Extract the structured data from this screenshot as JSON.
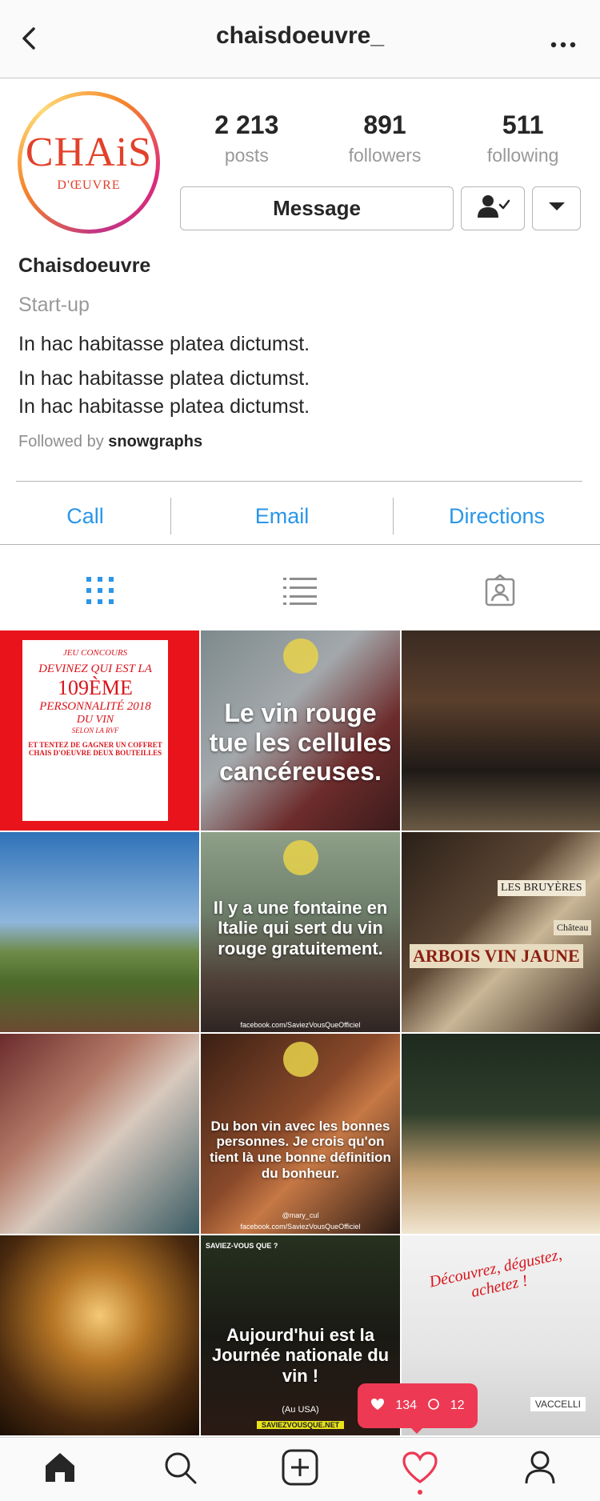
{
  "header": {
    "username": "chaisdoeuvre_"
  },
  "profile": {
    "logo_text": "CHAiS",
    "logo_sub": "D'ŒUVRE",
    "stats": [
      {
        "value": "2 213",
        "label": "posts"
      },
      {
        "value": "891",
        "label": "followers"
      },
      {
        "value": "511",
        "label": "following"
      }
    ],
    "message_label": "Message",
    "name": "Chaisdoeuvre",
    "category": "Start-up",
    "bio_lines": [
      "In hac habitasse platea dictumst.",
      "In hac habitasse platea dictumst.",
      "In hac habitasse platea dictumst."
    ],
    "followed_by_prefix": "Followed by",
    "followed_by_user": "snowgraphs"
  },
  "contact": {
    "call": "Call",
    "email": "Email",
    "directions": "Directions"
  },
  "tabs": [
    "grid-icon",
    "list-icon",
    "tagged-icon"
  ],
  "posts": [
    {
      "lines": [
        "JEU CONCOURS",
        "DEVINEZ QUI EST LA",
        "109ÈME",
        "PERSONNALITÉ 2018",
        "DU VIN",
        "SELON LA RVF",
        "ET TENTEZ DE GAGNER UN COFFRET",
        "CHAIS D'OEUVRE DEUX BOUTEILLES"
      ]
    },
    {
      "text": "Le vin rouge tue les cellules cancéreuses."
    },
    {
      "text": ""
    },
    {
      "text": ""
    },
    {
      "text": "Il y a une fontaine en Italie qui sert du vin rouge gratuitement.",
      "foot": "facebook.com/SaviezVousQueOfficiel"
    },
    {
      "text": "ARBOIS VIN JAUNE",
      "text2": "LES BRUYÈRES",
      "text3": "Château"
    },
    {
      "text": ""
    },
    {
      "text": "Du bon vin avec les bonnes personnes. Je crois qu'on tient là une bonne définition du bonheur.",
      "handle": "@mary_cul",
      "foot": "facebook.com/SaviezVousQueOfficiel"
    },
    {
      "text": ""
    },
    {
      "text": ""
    },
    {
      "top": "SAVIEZ-VOUS QUE ?",
      "text": "Aujourd'hui est la Journée nationale du vin !",
      "sub": "(Au USA)",
      "foot": "SAVIEZVOUSQUE.NET"
    },
    {
      "text": "Découvrez, dégustez, achetez !",
      "label": "VACCELLI"
    }
  ],
  "notification": {
    "likes": "134",
    "comments": "12"
  },
  "colors": {
    "accent": "#2a96e8",
    "notification": "#ed3954",
    "logo": "#e2412a"
  }
}
